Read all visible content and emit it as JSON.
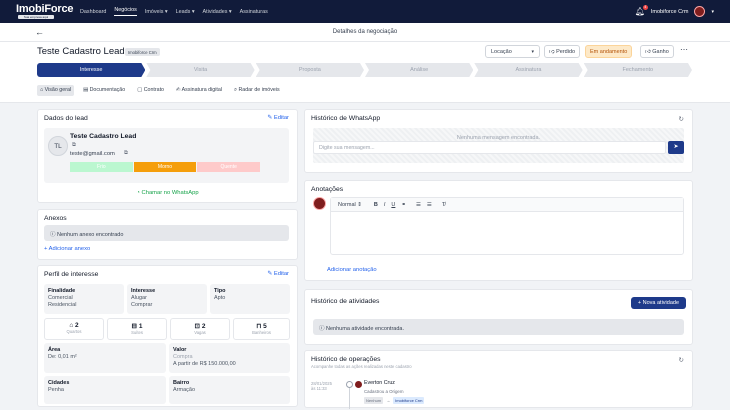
{
  "nav": {
    "logo": "ImobiForce",
    "logo_sub": "Sua empresa aqui",
    "links": [
      "Dashboard",
      "Negócios",
      "Imóveis ▾",
      "Leads ▾",
      "Atividades ▾",
      "Assinaturas"
    ],
    "notifications": "4",
    "user": "Imobiforce Crm"
  },
  "subheader": {
    "back": "←",
    "title": "Detalhes da negociação"
  },
  "deal": {
    "title": "Teste Cadastro Lead",
    "org": "Imobiforce Crm",
    "location_select": "Locação",
    "lost_label": "Perdido",
    "status_label": "Em andamento",
    "won_label": "Ganho",
    "more": "⋯"
  },
  "stages": [
    "Interesse",
    "Visita",
    "Proposta",
    "Análise",
    "Assinatura",
    "Fechamento"
  ],
  "tabs": [
    "Visão geral",
    "Documentação",
    "Contrato",
    "Assinatura digital",
    "Radar de imóveis"
  ],
  "lead": {
    "heading": "Dados do lead",
    "edit": "Editar",
    "initials": "TL",
    "name": "Teste Cadastro Lead",
    "email": "teste@gmail.com",
    "temps": [
      "Frio",
      "Morno",
      "Quente"
    ],
    "whatsapp": "Chamar no WhatsApp"
  },
  "attachments": {
    "heading": "Anexos",
    "empty": "Nenhum anexo encontrado",
    "add": "+ Adicionar anexo"
  },
  "profile": {
    "heading": "Perfil de interesse",
    "edit": "Editar",
    "finalidade_k": "Finalidade",
    "finalidade_v": [
      "Comercial",
      "Residencial"
    ],
    "interesse_k": "Interesse",
    "interesse_v": [
      "Alugar",
      "Comprar"
    ],
    "tipo_k": "Tipo",
    "tipo_v": "Apto",
    "pills": [
      {
        "num": "2",
        "lbl": "Quartos",
        "icon": "bed-icon"
      },
      {
        "num": "1",
        "lbl": "Suítes",
        "icon": "bath-icon"
      },
      {
        "num": "2",
        "lbl": "Vagas",
        "icon": "car-icon"
      },
      {
        "num": "5",
        "lbl": "Banheiros",
        "icon": "shower-icon"
      }
    ],
    "area_k": "Área",
    "area_v": "De: 0,01 m²",
    "valor_k": "Valor",
    "valor_mode": "Compra",
    "valor_v": "A partir de R$ 150.000,00",
    "cidades_k": "Cidades",
    "cidades_v": "Penha",
    "bairro_k": "Bairro",
    "bairro_v": "Armação"
  },
  "whatsapp_history": {
    "heading": "Histórico de WhatsApp",
    "empty": "Nenhuma mensagem encontrada.",
    "placeholder": "Digite sua mensagem..."
  },
  "notes": {
    "heading": "Anotações",
    "format": "Normal",
    "add": "Adicionar anotação"
  },
  "activities": {
    "heading": "Histórico de atividades",
    "new": "+ Nova atividade",
    "empty": "Nenhuma atividade encontrada."
  },
  "operations": {
    "heading": "Histórico de operações",
    "sub": "Acompanhe todas as ações realizadas neste cadastro",
    "date": "28/01/2025",
    "time": "às 11:33",
    "user": "Everton Cruz",
    "desc": "Cadastrou a Origem",
    "from": "Nenhum",
    "arrow": "→",
    "to": "Imobiforce Crm"
  },
  "colors": {
    "navy": "#111b3a",
    "primary": "#1e3a8a",
    "warm": "#f59e0b",
    "whatsapp": "#16a34a"
  }
}
